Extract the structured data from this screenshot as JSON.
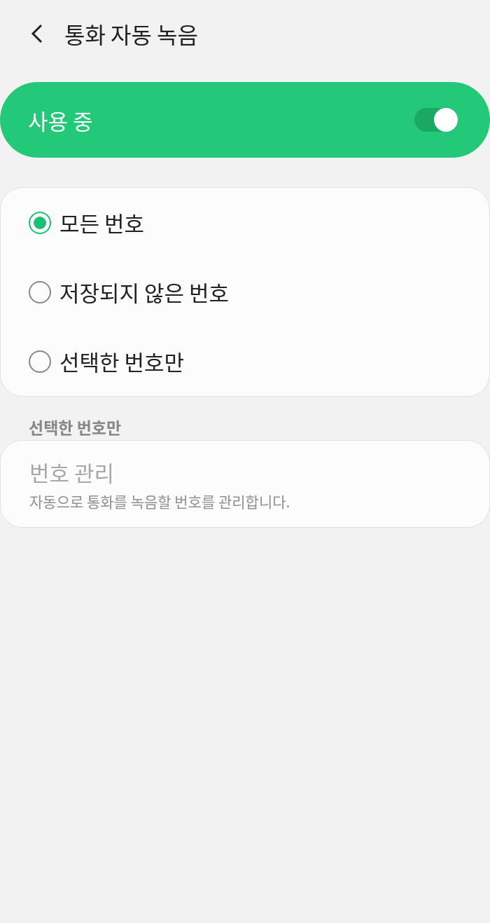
{
  "header": {
    "title": "통화 자동 녹음"
  },
  "master_switch": {
    "label": "사용 중",
    "on": true
  },
  "options": [
    {
      "label": "모든 번호",
      "selected": true
    },
    {
      "label": "저장되지 않은 번호",
      "selected": false
    },
    {
      "label": "선택한 번호만",
      "selected": false
    }
  ],
  "section_header": "선택한 번호만",
  "manage": {
    "title": "번호 관리",
    "subtitle": "자동으로 통화를 녹음할 번호를 관리합니다.",
    "disabled": true
  }
}
